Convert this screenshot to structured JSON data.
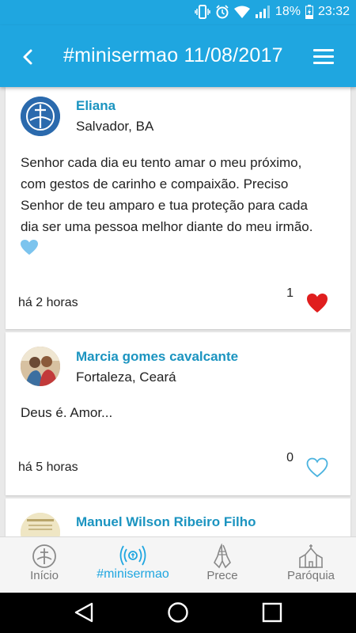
{
  "status": {
    "battery": "18%",
    "time": "23:32"
  },
  "appbar": {
    "title": "#minisermao 11/08/2017"
  },
  "posts": [
    {
      "author": "Eliana",
      "location": "Salvador, BA",
      "lines": [
        "Senhor cada dia eu tento amar o meu próximo,",
        "com gestos de carinho e compaixão. Preciso",
        "Senhor de teu amparo e tua proteção para cada",
        "dia ser uma pessoa melhor diante do meu irmão."
      ],
      "time": "há 2 horas",
      "likes": "1",
      "liked": true
    },
    {
      "author": "Marcia gomes cavalcante",
      "location": "Fortaleza, Ceará",
      "lines": [
        "Deus é. Amor..."
      ],
      "time": "há 5 horas",
      "likes": "0",
      "liked": false
    },
    {
      "author": "Manuel Wilson Ribeiro Filho"
    }
  ],
  "nav": {
    "inicio": "Início",
    "minisermao": "#minisermao",
    "prece": "Prece",
    "paroquia": "Paróquia"
  },
  "colors": {
    "primary": "#1fa6e0",
    "author": "#1b94c0",
    "like": "#e01e1e"
  }
}
